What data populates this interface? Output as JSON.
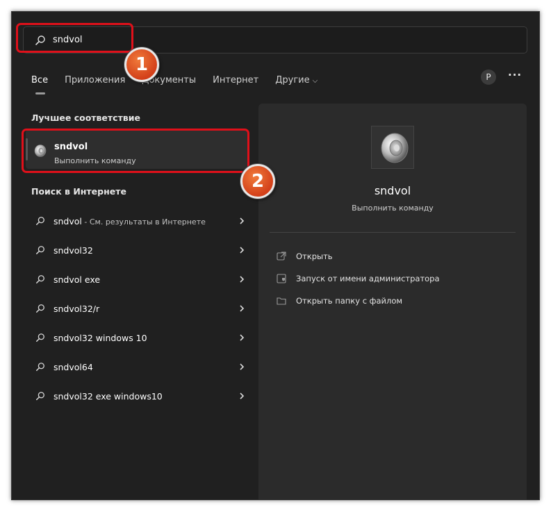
{
  "search": {
    "value": "sndvol",
    "placeholder": ""
  },
  "tabs": [
    {
      "label": "Все",
      "active": true
    },
    {
      "label": "Приложения"
    },
    {
      "label": "Документы"
    },
    {
      "label": "Интернет"
    },
    {
      "label": "Другие"
    }
  ],
  "account": {
    "avatar_letter": "P"
  },
  "more_label": "···",
  "best_match": {
    "heading": "Лучшее соответствие",
    "title": "sndvol",
    "subtitle": "Выполнить команду",
    "icon": "speaker-icon"
  },
  "web": {
    "heading": "Поиск в Интернете",
    "items": [
      {
        "text": "sndvol",
        "suffix": " - См. результаты в Интернете"
      },
      {
        "text": "sndvol32",
        "suffix": ""
      },
      {
        "text": "sndvol exe",
        "suffix": ""
      },
      {
        "text": "sndvol32/r",
        "suffix": ""
      },
      {
        "text": "sndvol32 windows 10",
        "suffix": ""
      },
      {
        "text": "sndvol64",
        "suffix": ""
      },
      {
        "text": "sndvol32 exe windows10",
        "suffix": ""
      }
    ]
  },
  "detail": {
    "title": "sndvol",
    "subtitle": "Выполнить команду",
    "actions": [
      {
        "label": "Открыть",
        "icon": "open-icon"
      },
      {
        "label": "Запуск от имени администратора",
        "icon": "shield-icon"
      },
      {
        "label": "Открыть папку с файлом",
        "icon": "folder-icon"
      }
    ]
  },
  "annotations": {
    "badge1": "1",
    "badge2": "2"
  },
  "colors": {
    "background": "#202020",
    "panel": "#2b2b2b",
    "highlight": "#e0101a",
    "badge": "#d3401a"
  }
}
